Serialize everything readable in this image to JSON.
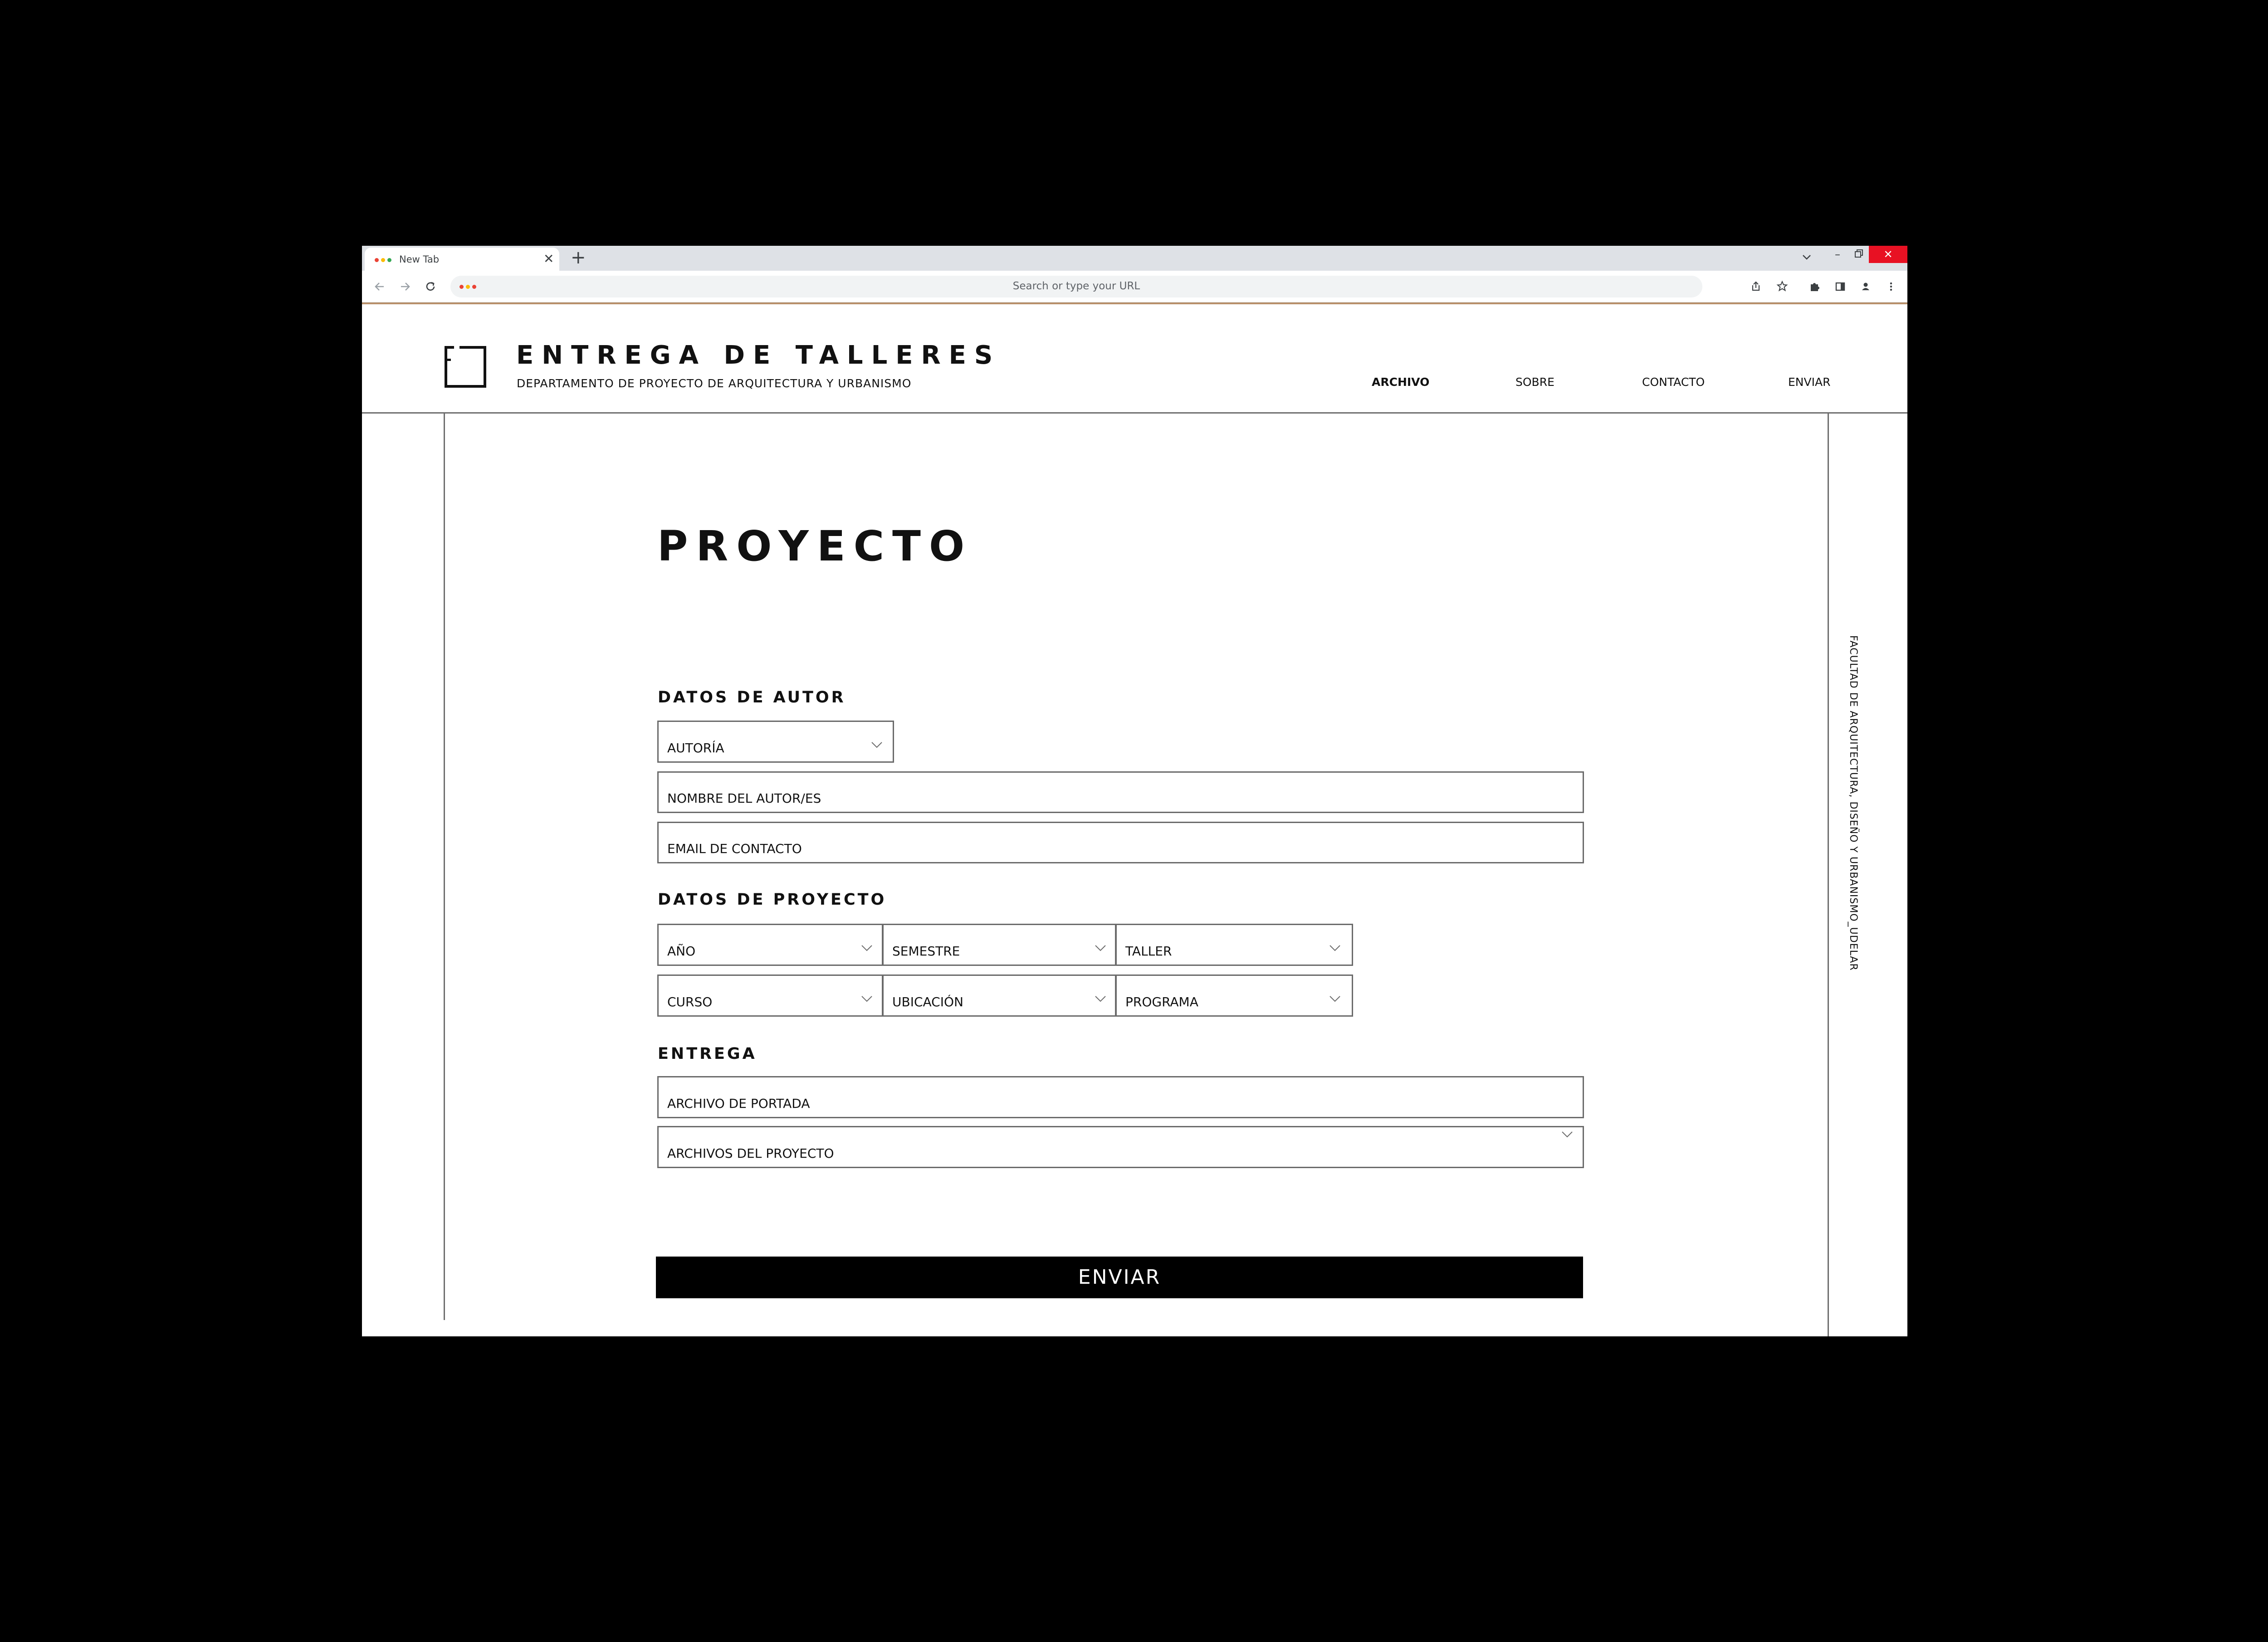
{
  "browser": {
    "tab_title": "New Tab",
    "tab_close_glyph": "✕",
    "new_tab_glyph": "+",
    "minimize_glyph": "–",
    "close_glyph": "✕",
    "address_placeholder": "Search or type your URL",
    "dot_colors": [
      "#ea4335",
      "#fbbc05",
      "#34a853"
    ],
    "close_button_color": "#e81123"
  },
  "header": {
    "title": "ENTREGA DE TALLERES",
    "subtitle": "DEPARTAMENTO DE PROYECTO DE ARQUITECTURA Y URBANISMO",
    "nav": [
      {
        "label": "ARCHIVO",
        "active": true
      },
      {
        "label": "SOBRE",
        "active": false
      },
      {
        "label": "CONTACTO",
        "active": false
      },
      {
        "label": "ENVIAR",
        "active": false
      }
    ]
  },
  "side_text": "FACULTAD DE ARQUITECTURA, DISEÑO Y URBANISMO_UDELAR",
  "form": {
    "title": "PROYECTO",
    "author_section": "DATOS DE AUTOR",
    "authorship_select": "AUTORÍA",
    "author_name": "NOMBRE DEL AUTOR/ES",
    "contact_email": "EMAIL DE CONTACTO",
    "project_section": "DATOS DE PROYECTO",
    "year_select": "AÑO",
    "semester_select": "SEMESTRE",
    "workshop_select": "TALLER",
    "course_select": "CURSO",
    "location_select": "UBICACIÓN",
    "program_select": "PROGRAMA",
    "delivery_section": "ENTREGA",
    "cover_file": "ARCHIVO DE PORTADA",
    "project_files": "ARCHIVOS DEL PROYECTO",
    "submit_label": "ENVIAR"
  }
}
